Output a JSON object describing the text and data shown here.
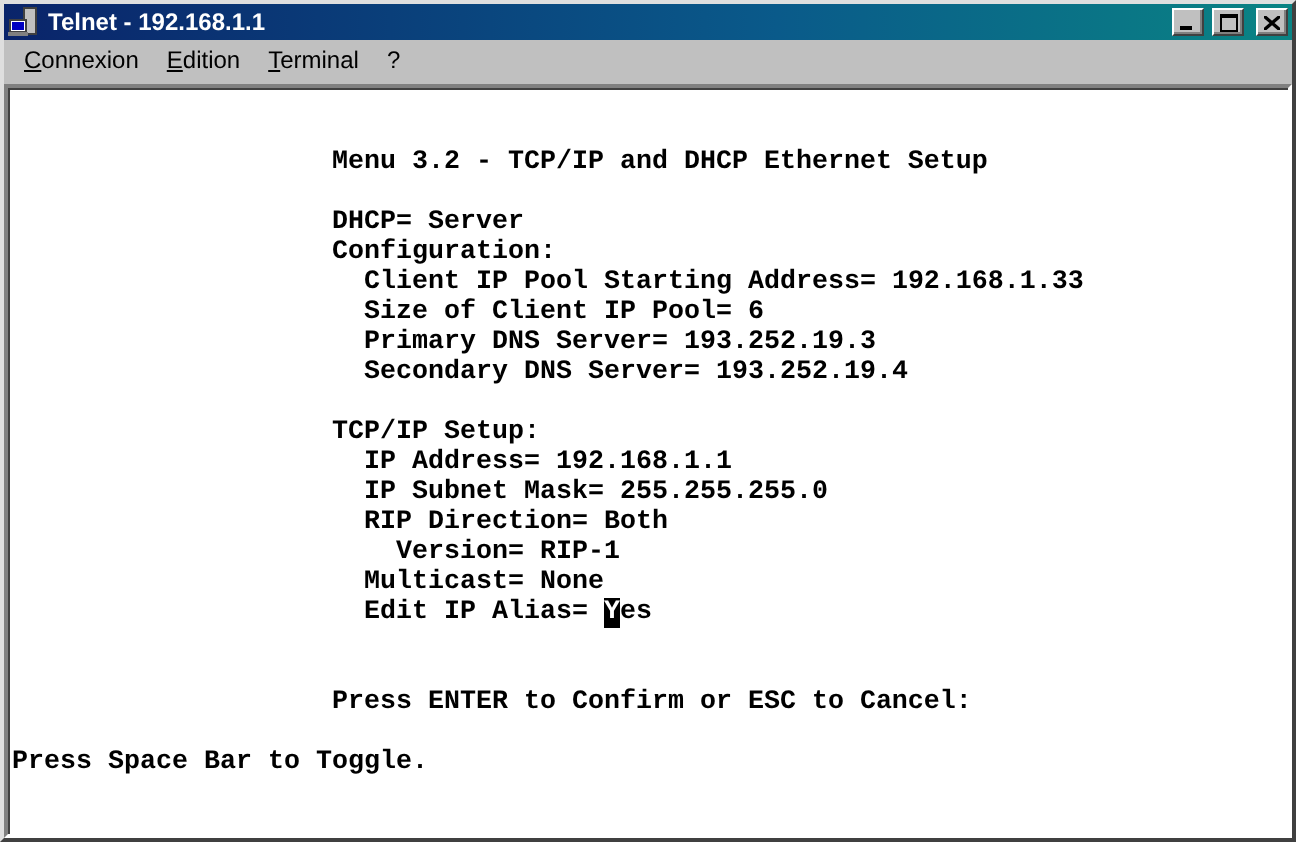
{
  "window": {
    "title": "Telnet - 192.168.1.1"
  },
  "menu": [
    {
      "label": "Connexion"
    },
    {
      "label": "Edition"
    },
    {
      "label": "Terminal"
    },
    {
      "label": "?"
    }
  ],
  "terminal": {
    "heading": "Menu 3.2 - TCP/IP and DHCP Ethernet Setup",
    "groups": [
      [
        {
          "text": "DHCP= Server"
        },
        {
          "text": "Configuration:",
          "children": [
            {
              "text": "Client IP Pool Starting Address= 192.168.1.33"
            },
            {
              "text": "Size of Client IP Pool= 6"
            },
            {
              "text": "Primary DNS Server= 193.252.19.3"
            },
            {
              "text": "Secondary DNS Server= 193.252.19.4"
            }
          ]
        }
      ],
      [
        {
          "text": "TCP/IP Setup:",
          "children": [
            {
              "text": "IP Address= 192.168.1.1"
            },
            {
              "text": "IP Subnet Mask= 255.255.255.0"
            },
            {
              "text": "RIP Direction= Both",
              "children": [
                {
                  "text": "Version= RIP-1"
                }
              ]
            },
            {
              "text": "Multicast= None"
            },
            {
              "text": "Edit IP Alias= ",
              "value": "Yes",
              "cursor": true
            }
          ]
        }
      ]
    ],
    "prompt": "Press ENTER to Confirm or ESC to Cancel:",
    "status_line": "Press Space Bar to Toggle."
  }
}
